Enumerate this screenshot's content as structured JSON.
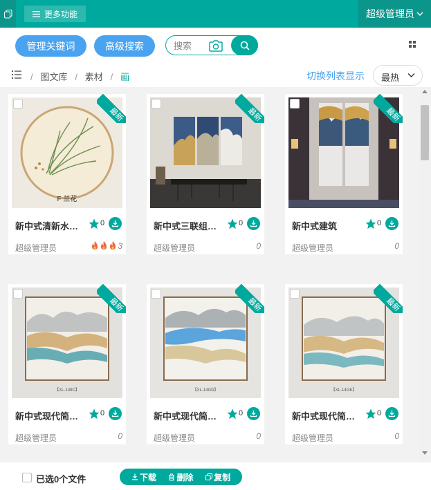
{
  "topbar": {
    "more_label": "更多功能",
    "admin_label": "超级管理员"
  },
  "toolbar": {
    "manage_keywords_label": "管理关键词",
    "advanced_search_label": "高级搜索",
    "search_placeholder": "搜索"
  },
  "breadcrumb": {
    "items": [
      "图文库",
      "素材",
      "画"
    ],
    "separator": "/"
  },
  "switch_view_label": "切换列表显示",
  "sort_label": "最热",
  "badge_label": "最新",
  "cards": [
    {
      "title": "新中式清新水墨兰花装饰画",
      "count": "0",
      "author": "超级管理员",
      "heat": "3",
      "fires": 3
    },
    {
      "title": "新中式三联组合装饰画",
      "count": "0",
      "author": "超级管理员",
      "heat": "0",
      "fires": 0
    },
    {
      "title": "新中式建筑",
      "count": "0",
      "author": "超级管理员",
      "heat": "0",
      "fires": 0
    },
    {
      "title": "新中式现代简约装饰画",
      "count": "0",
      "author": "超级管理员",
      "heat": "0",
      "fires": 0
    },
    {
      "title": "新中式现代简约装饰画",
      "count": "0",
      "author": "超级管理员",
      "heat": "0",
      "fires": 0
    },
    {
      "title": "新中式现代简约装饰画",
      "count": "0",
      "author": "超级管理员",
      "heat": "0",
      "fires": 0
    }
  ],
  "image_captions": {
    "orchid": "F 兰花",
    "c1": "【XL-149C】",
    "c2": "【XL-14GD】",
    "c3": "【XL-14GE】"
  },
  "footer": {
    "selected_label": "已选0个文件",
    "download_label": "下载",
    "delete_label": "删除",
    "copy_label": "复制"
  },
  "colors": {
    "brand": "#00a99d",
    "accent": "#4aa3f0"
  }
}
